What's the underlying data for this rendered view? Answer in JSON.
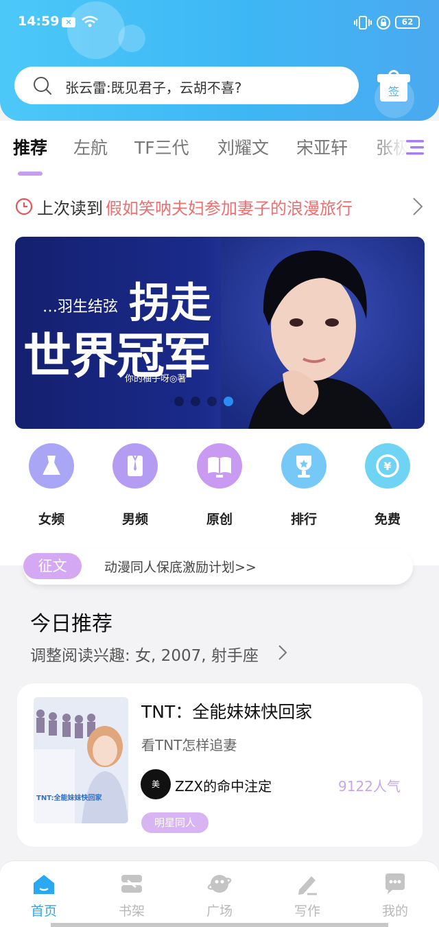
{
  "status_bar": {
    "time": "14:59",
    "battery": "62"
  },
  "search": {
    "placeholder": "张云雷:既见君子，云胡不喜?"
  },
  "checkin": {
    "label": "签"
  },
  "tabs": [
    {
      "label": "推荐",
      "active": true
    },
    {
      "label": "左航"
    },
    {
      "label": "TF三代"
    },
    {
      "label": "刘耀文"
    },
    {
      "label": "宋亚轩"
    },
    {
      "label": "张极"
    }
  ],
  "last_read": {
    "label": "上次读到",
    "title": "假如笑呐夫妇参加妻子的浪漫旅行"
  },
  "banner": {
    "subtitle": "…羽生结弦",
    "title_line1": "拐走",
    "title_line2": "世界冠军",
    "author": "你的柚子呀◎著",
    "active_slide": 4,
    "slide_count": 4
  },
  "categories": [
    {
      "label": "女频",
      "icon": "dress-icon",
      "color": "#a9a6f5"
    },
    {
      "label": "男频",
      "icon": "shirt-icon",
      "color": "#b49cf3"
    },
    {
      "label": "原创",
      "icon": "book-icon",
      "color": "#c99af2"
    },
    {
      "label": "排行",
      "icon": "trophy-icon",
      "color": "#76c9f7"
    },
    {
      "label": "免费",
      "icon": "yuan-icon",
      "color": "#6fd4f4"
    }
  ],
  "contest": {
    "badge": "征文",
    "text": "动漫同人保底激励计划>>"
  },
  "today": {
    "title": "今日推荐",
    "subtitle": "调整阅读兴趣: 女, 2007, 射手座"
  },
  "book": {
    "title": "TNT：全能妹妹快回家",
    "description": "看TNT怎样追妻",
    "cover_text": "TNT:全能妹妹快回家",
    "author_avatar_text": "美",
    "author": "ZZX的命中注定",
    "popularity": "9122人气",
    "tag": "明星同人"
  },
  "nav": [
    {
      "label": "首页",
      "icon": "home-icon",
      "active": true
    },
    {
      "label": "书架",
      "icon": "bookshelf-icon"
    },
    {
      "label": "广场",
      "icon": "planet-icon"
    },
    {
      "label": "写作",
      "icon": "pen-icon"
    },
    {
      "label": "我的",
      "icon": "chat-bubble-icon"
    }
  ],
  "colors": {
    "header": "#3eb7f5",
    "accent_purple": "#c59ef0",
    "last_read_red": "#ee6f70",
    "nav_active": "#2aa8f2"
  }
}
